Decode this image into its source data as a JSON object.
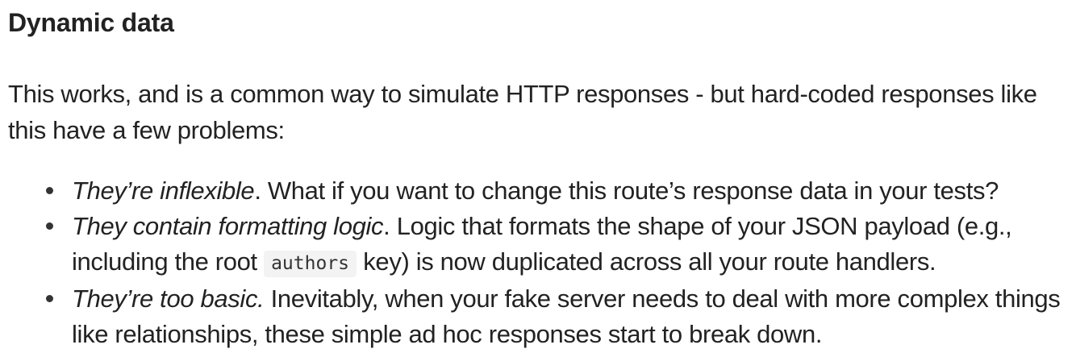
{
  "heading": "Dynamic data",
  "intro": "This works, and is a common way to simulate HTTP responses - but hard-coded responses like this have a few problems:",
  "problems": [
    {
      "title": "They’re inflexible",
      "title_suffix": ".",
      "text": " What if you want to change this route’s response data in your tests?"
    },
    {
      "title": "They contain formatting logic",
      "title_suffix": ".",
      "text_before": " Logic that formats the shape of your JSON payload (e.g., including the root ",
      "code": "authors",
      "text_after": " key) is now duplicated across all your route handlers."
    },
    {
      "title": "They’re too basic.",
      "text": " Inevitably, when your fake server needs to deal with more complex things like relationships, these simple ad hoc responses start to break down."
    }
  ]
}
